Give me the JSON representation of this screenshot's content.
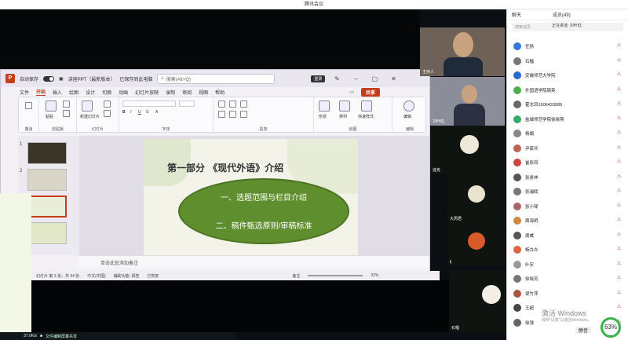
{
  "window": {
    "title": "腾讯会议"
  },
  "ppt": {
    "autosave_label": "自动保存",
    "doc_title": "讲座PPT（最新版本）",
    "saved_status": "已保存到此电脑",
    "search_placeholder": "搜索(Alt+Q)",
    "login_label": "登录",
    "share_label": "共享",
    "menu": [
      "文件",
      "开始",
      "插入",
      "绘图",
      "设计",
      "切换",
      "动画",
      "幻灯片放映",
      "录制",
      "审阅",
      "视图",
      "帮助"
    ],
    "ribbon_groups": {
      "undo": "撤消",
      "clipboard": "剪贴板",
      "slides": "幻灯片",
      "font": "字体",
      "paragraph": "段落",
      "drawing": "绘图",
      "editing": "编辑"
    },
    "ribbon_labels": {
      "paste": "粘贴",
      "new_slide": "新建幻灯片",
      "shapes": "形状",
      "arrange": "排列",
      "quick_styles": "快速样式",
      "edit": "编辑"
    },
    "slide_numbers": [
      "1",
      "2",
      "3",
      "4",
      "5"
    ],
    "notes_placeholder": "单击此处添加备注",
    "status": {
      "slide_info": "幻灯片 第 3 张，共 44 张",
      "language": "中文(中国)",
      "accessibility": "辅助功能: 调查",
      "restored": "已恢复",
      "notes": "备注",
      "zoom": "32%"
    }
  },
  "slide": {
    "title": "第一部分 《现代外语》介绍",
    "item1": "一、选题范围与栏目介绍",
    "item2": "二、稿件甄选原则/审稿标准"
  },
  "video_tiles": [
    {
      "name": "主持人"
    },
    {
      "name": "刘叶虹"
    },
    {
      "name": "迪克"
    },
    {
      "name": "大周君"
    },
    {
      "name": "lj"
    },
    {
      "name": "石榴"
    }
  ],
  "panel": {
    "tabs": [
      "聊天",
      "成员(49)"
    ],
    "search_placeholder": "搜索成员",
    "speaking": "正在讲话: 刘叶虹;",
    "members": [
      {
        "name": "任扬",
        "color": "#3a78d6"
      },
      {
        "name": "石榴",
        "color": "#777"
      },
      {
        "name": "安徽师范大学院",
        "color": "#2a6ad0"
      },
      {
        "name": "外国语学院周英",
        "color": "#4caf50"
      },
      {
        "name": "霍志凤1606433089",
        "color": "#666"
      },
      {
        "name": "盐城师范学院徐晓燕",
        "color": "#3a6"
      },
      {
        "name": "杨娟",
        "color": "#888"
      },
      {
        "name": "尹家兵",
        "color": "#b65"
      },
      {
        "name": "崔彩凤",
        "color": "#c44"
      },
      {
        "name": "张贵林",
        "color": "#555"
      },
      {
        "name": "张浦辉",
        "color": "#777"
      },
      {
        "name": "张小琴",
        "color": "#a66"
      },
      {
        "name": "周海明",
        "color": "#c84"
      },
      {
        "name": "周威",
        "color": "#555"
      },
      {
        "name": "杨卉卉",
        "color": "#d64"
      },
      {
        "name": "叶安",
        "color": "#999"
      },
      {
        "name": "徐晓芳",
        "color": "#777"
      },
      {
        "name": "梁竹萍",
        "color": "#a54"
      },
      {
        "name": "王超",
        "color": "#444"
      },
      {
        "name": "徐强",
        "color": "#666"
      }
    ],
    "activate_title": "激活 Windows",
    "activate_sub": "转到\"设置\"以激活Windows。",
    "mute_label": "静音",
    "cpu_percent": "63%"
  },
  "taskbar": {
    "sharing_text": "文件编制屏幕共享",
    "net_speed": "37.0K/s"
  }
}
